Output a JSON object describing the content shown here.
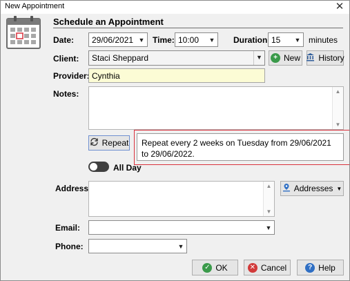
{
  "window": {
    "title": "New Appointment",
    "close_glyph": "✕"
  },
  "header": {
    "section_title": "Schedule an Appointment"
  },
  "form": {
    "date_label": "Date:",
    "date_value": "29/06/2021",
    "time_label": "Time:",
    "time_value": "10:00",
    "duration_label": "Duration:",
    "duration_value": "15",
    "duration_unit": "minutes",
    "client_label": "Client:",
    "client_value": "Staci Sheppard",
    "new_button": "New",
    "history_button": "History",
    "provider_label": "Provider:",
    "provider_value": "Cynthia",
    "notes_label": "Notes:",
    "notes_value": "",
    "repeat_button": "Repeat",
    "repeat_summary": "Repeat every 2 weeks on Tuesday from 29/06/2021 to 29/06/2022.",
    "all_day_label": "All Day",
    "all_day_on": false,
    "address_label": "Address:",
    "address_value": "",
    "addresses_button": "Addresses",
    "email_label": "Email:",
    "email_value": "",
    "phone_label": "Phone:",
    "phone_value": ""
  },
  "footer": {
    "ok_button": "OK",
    "cancel_button": "Cancel",
    "help_button": "Help"
  },
  "colors": {
    "highlight": "#d9303c",
    "ok_green": "#3a9a4a",
    "cancel_red": "#d23a3a",
    "help_blue": "#2f6fc4",
    "provider_bg": "#fcfcd5"
  },
  "icons": [
    "calendar-icon",
    "plus-circle-icon",
    "bank-icon",
    "repeat-icon",
    "map-pin-icon",
    "check-circle-icon",
    "x-circle-icon",
    "question-circle-icon"
  ]
}
